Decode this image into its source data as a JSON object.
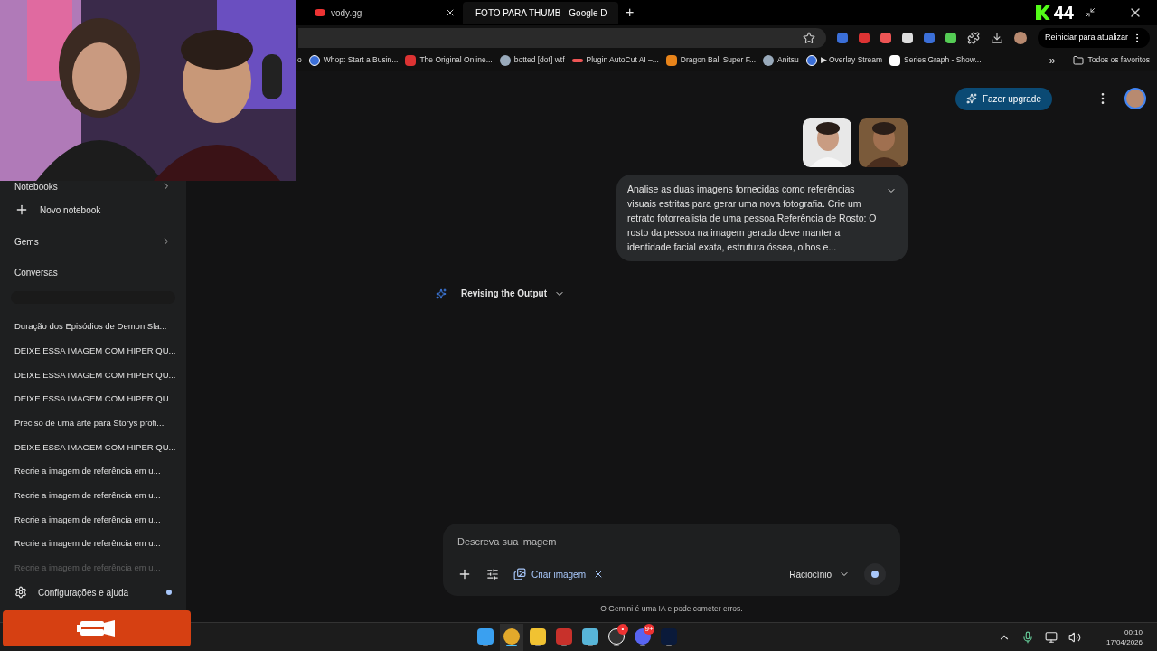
{
  "browser": {
    "tabs": [
      {
        "title": "vody.gg",
        "selected": false,
        "kind": "video"
      },
      {
        "title": "FOTO PARA THUMB - Google D",
        "selected": true,
        "kind": "drive"
      }
    ],
    "new_tab": "+",
    "counter": "44",
    "update_button": "Reiniciar para atualizar",
    "bookmarks": [
      {
        "label": "o",
        "kind": "cut"
      },
      {
        "label": "Whop: Start a Busin...",
        "kind": "globe"
      },
      {
        "label": "The Original Online...",
        "kind": "red"
      },
      {
        "label": "botted [dot] wtf",
        "kind": "bot"
      },
      {
        "label": "Plugin AutoCut AI –...",
        "kind": "dots"
      },
      {
        "label": "Dragon Ball Super F...",
        "kind": "orange"
      },
      {
        "label": "Anitsu",
        "kind": "bot"
      },
      {
        "label": "▶ Overlay Stream",
        "kind": "globe"
      },
      {
        "label": "Series Graph - Show...",
        "kind": "s"
      }
    ],
    "more_bookmarks": "»",
    "all_bookmarks": "Todos os favoritos"
  },
  "sidebar": {
    "sections": [
      {
        "label": "Notebooks",
        "kind": "expandable"
      },
      {
        "label": "Novo notebook",
        "kind": "action"
      },
      {
        "label": "Gems",
        "kind": "expandable"
      },
      {
        "label": "Conversas",
        "kind": "heading"
      }
    ],
    "conversations": [
      {
        "title": "Duração dos Episódios de Demon Sla...",
        "faded": false
      },
      {
        "title": "DEIXE ESSA IMAGEM COM HIPER QU...",
        "faded": false
      },
      {
        "title": "DEIXE ESSA IMAGEM COM HIPER QU...",
        "faded": false
      },
      {
        "title": "DEIXE ESSA IMAGEM COM HIPER QU...",
        "faded": false
      },
      {
        "title": "Preciso de uma arte para Storys profi...",
        "faded": false
      },
      {
        "title": "DEIXE ESSA IMAGEM COM HIPER QU...",
        "faded": false
      },
      {
        "title": "Recrie a imagem de referência em u...",
        "faded": false
      },
      {
        "title": "Recrie a imagem de referência em u...",
        "faded": false
      },
      {
        "title": "Recrie a imagem de referência em u...",
        "faded": false
      },
      {
        "title": "Recrie a imagem de referência em u...",
        "faded": false
      },
      {
        "title": "Recrie a imagem de referência em u...",
        "faded": true
      }
    ],
    "settings": {
      "label": "Configurações e ajuda",
      "notification": true
    }
  },
  "header": {
    "upgrade_button": "Fazer upgrade"
  },
  "chat": {
    "prompt": "Analise as duas imagens fornecidas como referências visuais estritas para gerar uma nova fotografia. Crie um retrato fotorrealista de uma pessoa.Referência de Rosto: O rosto da pessoa na imagem gerada deve manter a identidade facial exata, estrutura óssea, olhos e...",
    "status": "Revising the Output"
  },
  "composer": {
    "placeholder": "Descreva sua imagem",
    "tool_chip": "Criar imagem",
    "mode": "Raciocínio",
    "disclaimer": "O Gemini é uma IA e pode cometer erros."
  },
  "taskbar": {
    "apps": [
      {
        "kind": "windows",
        "active": false
      },
      {
        "kind": "chrome",
        "active": true
      },
      {
        "kind": "folder",
        "active": false
      },
      {
        "kind": "voicemeeter",
        "active": false
      },
      {
        "kind": "notepad",
        "active": false
      },
      {
        "kind": "obs",
        "active": false,
        "badge": "•"
      },
      {
        "kind": "discord",
        "active": false,
        "badge": "9+"
      },
      {
        "kind": "photoshop",
        "active": false
      }
    ],
    "time": "00:10",
    "date": "17/04/2026"
  }
}
